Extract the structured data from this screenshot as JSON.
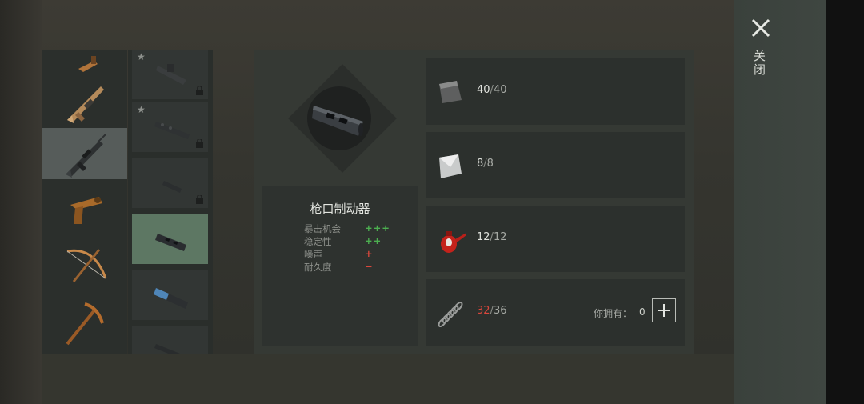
{
  "window": {
    "close_label": "关闭"
  },
  "weapons": [
    {
      "name": "crossbow-pistol-icon",
      "active": false
    },
    {
      "name": "assault-rifle-tan-icon",
      "active": false
    },
    {
      "name": "assault-rifle-m4-icon",
      "active": true
    },
    {
      "name": "flare-gun-icon",
      "active": false
    },
    {
      "name": "crossbow-icon",
      "active": false
    },
    {
      "name": "pickaxe-icon",
      "active": false
    }
  ],
  "attachments": [
    {
      "name": "scope-icon",
      "starred": true,
      "locked": true,
      "selected": false
    },
    {
      "name": "long-suppressor-icon",
      "starred": true,
      "locked": true,
      "selected": false
    },
    {
      "name": "short-barrel-icon",
      "starred": false,
      "locked": true,
      "selected": false
    },
    {
      "name": "muzzle-brake-icon",
      "starred": false,
      "locked": false,
      "selected": true
    },
    {
      "name": "blue-suppressor-icon",
      "starred": false,
      "locked": false,
      "selected": false
    },
    {
      "name": "barrel-extension-icon",
      "starred": false,
      "locked": false,
      "selected": false
    }
  ],
  "mod": {
    "title": "枪口制动器",
    "stats": [
      {
        "label": "暴击机会",
        "value": "+++",
        "kind": "positive"
      },
      {
        "label": "稳定性",
        "value": "++",
        "kind": "positive"
      },
      {
        "label": "噪声",
        "value": "+",
        "kind": "negative"
      },
      {
        "label": "耐久度",
        "value": "−",
        "kind": "negative"
      }
    ]
  },
  "materials": [
    {
      "icon": "metal-plate-icon",
      "have": "40",
      "separator": "/",
      "need": "40",
      "short": false
    },
    {
      "icon": "steel-sheet-icon",
      "have": "8",
      "separator": "/",
      "need": "8",
      "short": false
    },
    {
      "icon": "oil-can-icon",
      "have": "12",
      "separator": "/",
      "need": "12",
      "short": false
    },
    {
      "icon": "spring-icon",
      "have": "32",
      "separator": "/",
      "need": "36",
      "short": true,
      "own_label": "你拥有：",
      "own_value": "0"
    }
  ]
}
